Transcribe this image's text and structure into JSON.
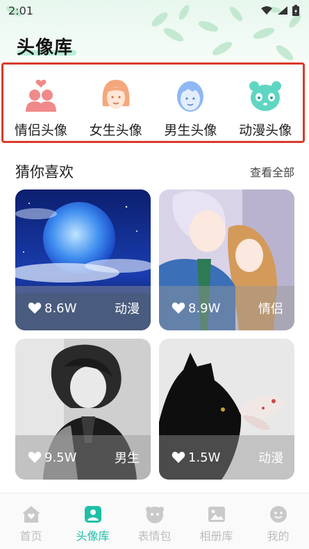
{
  "status": {
    "time": "2:01"
  },
  "header": {
    "title": "头像库"
  },
  "categories": [
    {
      "label": "情侣头像",
      "icon": "couple-icon",
      "color": "#f08a8a"
    },
    {
      "label": "女生头像",
      "icon": "girl-icon",
      "color": "#f5a77b"
    },
    {
      "label": "男生头像",
      "icon": "boy-icon",
      "color": "#8fb8f5"
    },
    {
      "label": "动漫头像",
      "icon": "panda-icon",
      "color": "#5fd6c2"
    }
  ],
  "section": {
    "title": "猜你喜欢",
    "more": "查看全部"
  },
  "cards": [
    {
      "likes": "8.6W",
      "tag": "动漫"
    },
    {
      "likes": "8.9W",
      "tag": "情侣"
    },
    {
      "likes": "9.5W",
      "tag": "男生"
    },
    {
      "likes": "1.5W",
      "tag": "动漫"
    }
  ],
  "tabs": [
    {
      "label": "首页",
      "icon": "home-icon",
      "active": false
    },
    {
      "label": "头像库",
      "icon": "avatar-icon",
      "active": true
    },
    {
      "label": "表情包",
      "icon": "emoji-icon",
      "active": false
    },
    {
      "label": "相册库",
      "icon": "album-icon",
      "active": false
    },
    {
      "label": "我的",
      "icon": "smile-icon",
      "active": false
    }
  ],
  "colors": {
    "accent": "#1fbfa8",
    "highlight_border": "#d93a2b"
  }
}
